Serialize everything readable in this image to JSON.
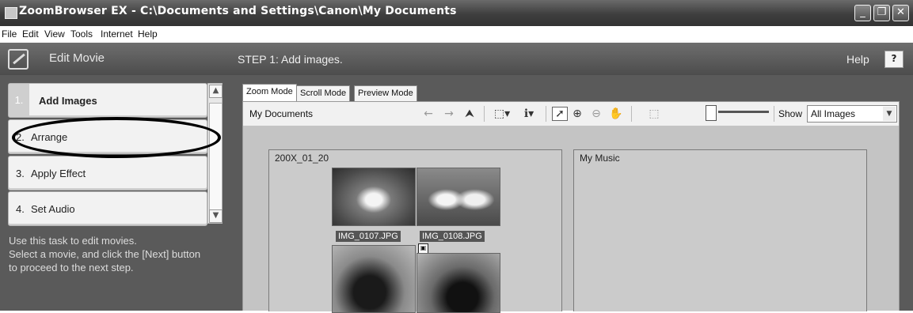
{
  "window": {
    "title": "ZoomBrowser EX  -  C:\\Documents and Settings\\Canon\\My Documents",
    "controls": {
      "minimize": "_",
      "restore": "❐",
      "close": "✕"
    }
  },
  "menu": [
    "File",
    "Edit",
    "View",
    "Tools",
    "Internet",
    "Help"
  ],
  "sidebar": {
    "title": "Edit Movie",
    "steps": [
      {
        "num": "1.",
        "label": "Add Images"
      },
      {
        "num": "2.",
        "label": "Arrange"
      },
      {
        "num": "3.",
        "label": "Apply Effect"
      },
      {
        "num": "4.",
        "label": "Set Audio"
      }
    ],
    "help_text": "Use this task to edit movies.\n Select a movie, and click the [Next] button to proceed to the next step."
  },
  "header": {
    "step_title": "STEP 1: Add images.",
    "help_label": "Help",
    "help_button": "?"
  },
  "tabs": [
    "Zoom Mode",
    "Scroll Mode",
    "Preview Mode"
  ],
  "toolbar": {
    "location": "My Documents",
    "show_label": "Show",
    "show_value": "All Images"
  },
  "folders": [
    {
      "name": "200X_01_20",
      "images": [
        "IMG_0107.JPG",
        "IMG_0108.JPG"
      ]
    },
    {
      "name": "My Music"
    }
  ],
  "colors": {
    "panel": "#5a5a5a",
    "titlebar": "#4a4a4a",
    "view": "#c4c4c4"
  }
}
